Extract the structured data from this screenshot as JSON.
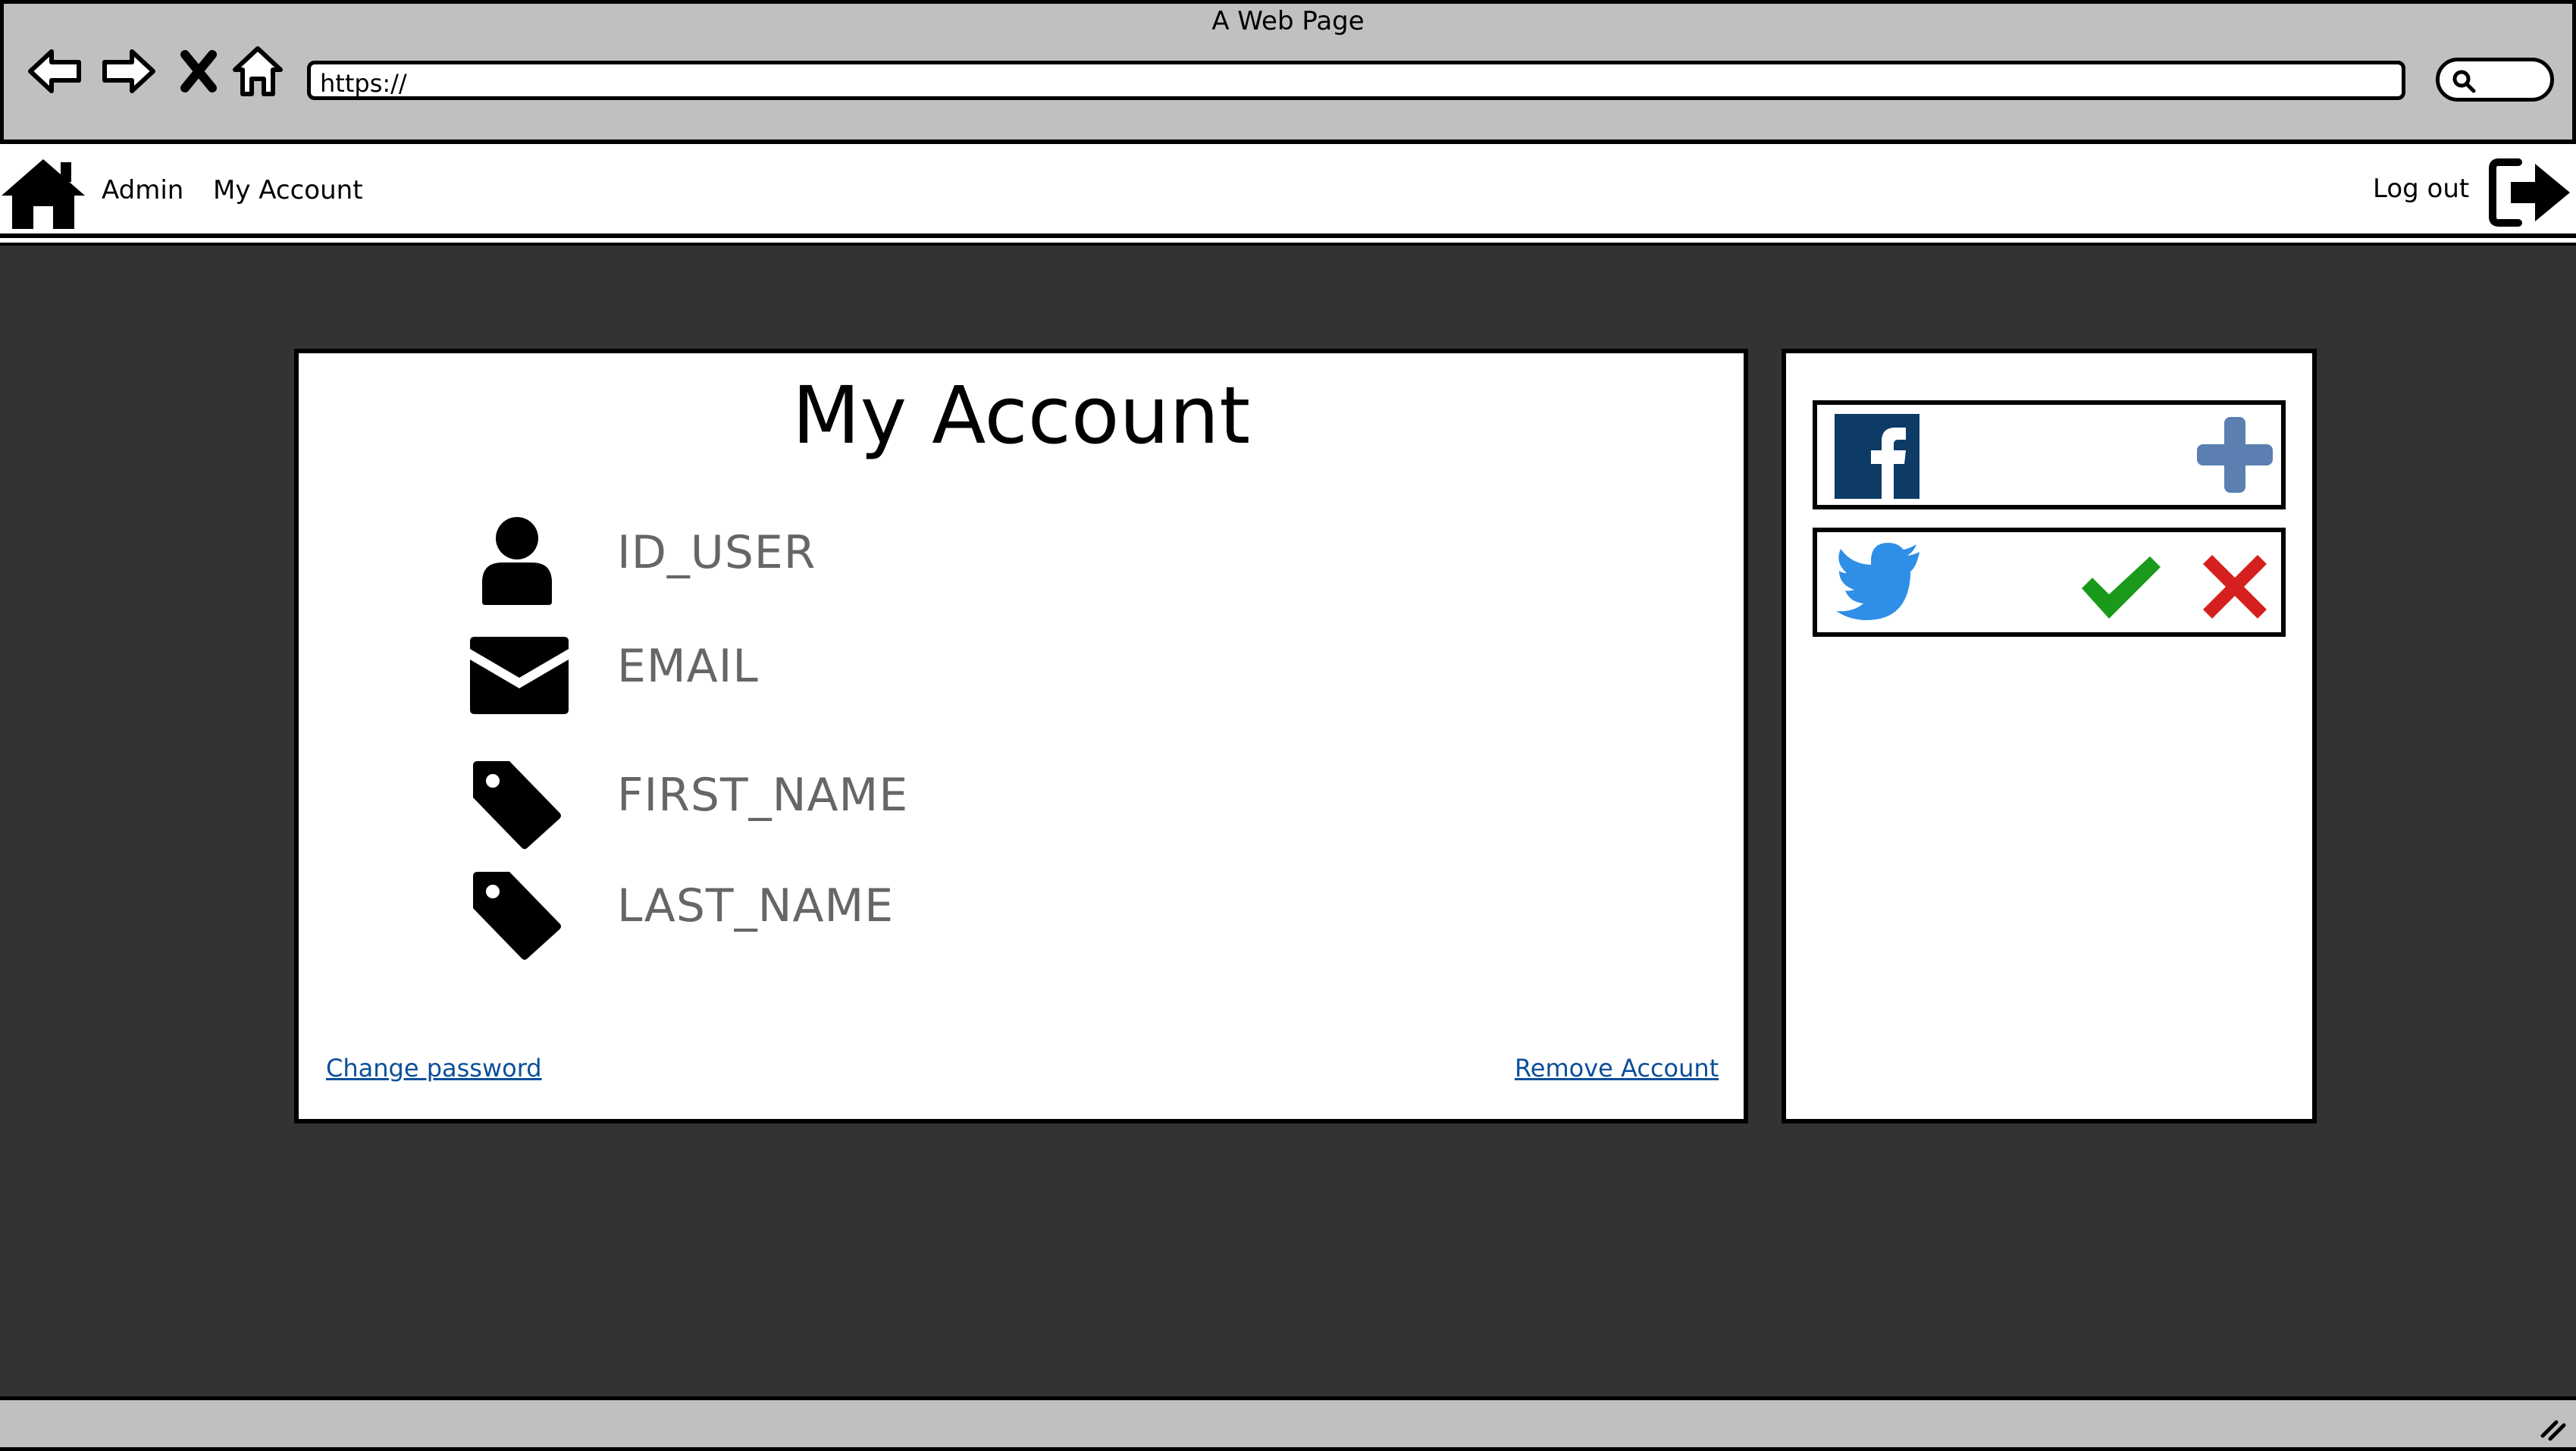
{
  "browser": {
    "window_title": "A Web Page",
    "url": "https://"
  },
  "navbar": {
    "links": [
      {
        "label": "Admin"
      },
      {
        "label": "My Account"
      }
    ],
    "logout_label": "Log out"
  },
  "account": {
    "title": "My Account",
    "fields": [
      {
        "label": "ID_USER",
        "icon": "user-icon"
      },
      {
        "label": "EMAIL",
        "icon": "envelope-icon"
      },
      {
        "label": "FIRST_NAME",
        "icon": "tag-icon"
      },
      {
        "label": "LAST_NAME",
        "icon": "tag-icon"
      }
    ],
    "change_password_label": "Change password",
    "remove_account_label": "Remove Account"
  },
  "social": {
    "accounts": [
      {
        "network": "facebook",
        "icon": "facebook-icon",
        "actions": [
          "plus-icon"
        ],
        "color": "#0d3b66"
      },
      {
        "network": "twitter",
        "icon": "twitter-icon",
        "actions": [
          "check-icon",
          "close-icon"
        ],
        "color": "#2f8ee6"
      }
    ]
  },
  "colors": {
    "chrome": "#c0c0c0",
    "background": "#333333",
    "link": "#0b4f9a",
    "check": "#1a9a1a",
    "cross": "#d62020",
    "plus": "#5a7fb0"
  }
}
